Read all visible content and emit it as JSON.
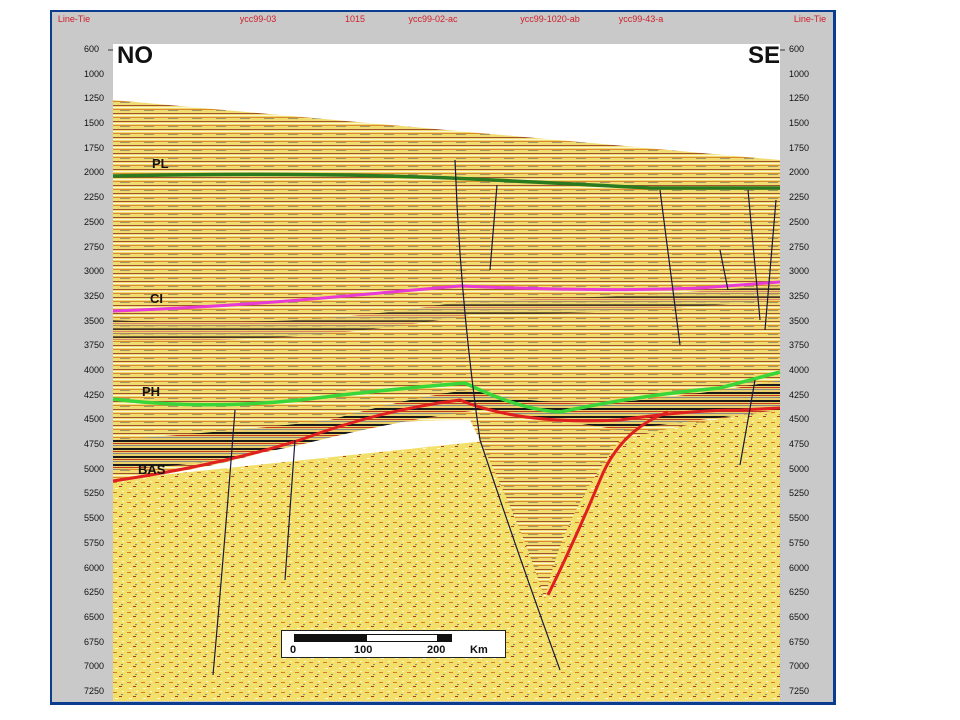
{
  "top_labels": [
    "Line-Tie",
    "ycc99-03",
    "1015",
    "ycc99-02-ac",
    "ycc99-1020-ab",
    "ycc99-43-a",
    "Line-Tie"
  ],
  "direction": {
    "left": "NO",
    "right": "SE"
  },
  "horizons": [
    {
      "label": "PL",
      "color": "#2a7a1f"
    },
    {
      "label": "CI",
      "color": "#e83ad6"
    },
    {
      "label": "PH",
      "color": "#39d63a"
    },
    {
      "label": "BAS",
      "color": "#e02020"
    }
  ],
  "depth_ticks": [
    "600",
    "1000",
    "1250",
    "1500",
    "1750",
    "2000",
    "2250",
    "2500",
    "2750",
    "3000",
    "3250",
    "3500",
    "3750",
    "4000",
    "4250",
    "4500",
    "4750",
    "5000",
    "5250",
    "5500",
    "5750",
    "6000",
    "6250",
    "6500",
    "6750",
    "7000",
    "7250"
  ],
  "scale_bar": {
    "labels": [
      "0",
      "100",
      "200"
    ],
    "unit": "Km"
  },
  "colors": {
    "frame": "#0a3d8f",
    "background_yellow": "#f2e06a",
    "label_red": "#d0202a"
  }
}
